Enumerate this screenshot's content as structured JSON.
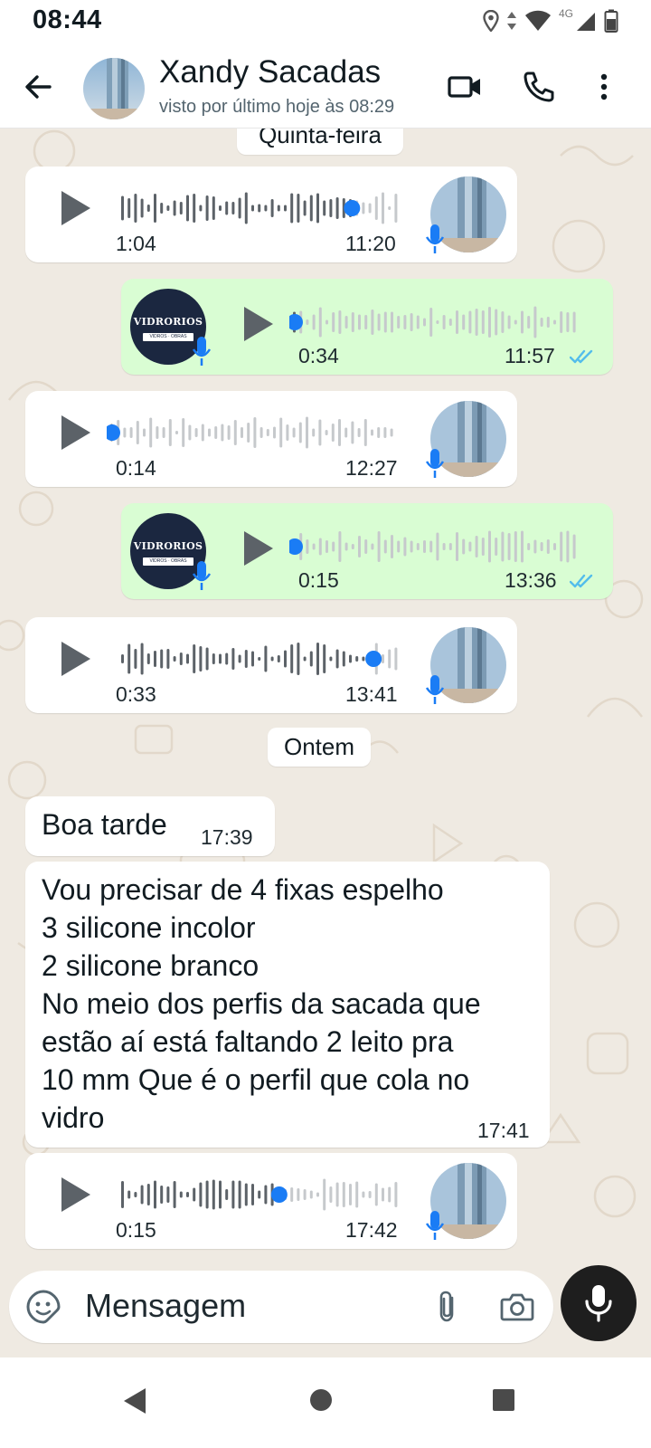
{
  "status_bar": {
    "time": "08:44",
    "network": "4G",
    "icons": [
      "location-icon",
      "data-arrows-icon",
      "wifi-icon",
      "signal-icon",
      "battery-icon"
    ]
  },
  "header": {
    "contact_name": "Xandy Sacadas",
    "contact_status": "visto por último hoje às 08:29",
    "icons": [
      "back-arrow-icon",
      "video-call-icon",
      "phone-icon",
      "more-options-icon"
    ]
  },
  "chat": {
    "top_date_label": "Quinta-feira",
    "date_separator": "Ontem",
    "messages": [
      {
        "type": "audio",
        "direction": "incoming",
        "duration": "1:04",
        "time": "11:20",
        "progress": 0.85
      },
      {
        "type": "audio",
        "direction": "outgoing",
        "duration": "0:34",
        "time": "11:57",
        "status": "read",
        "progress": 0.0
      },
      {
        "type": "audio",
        "direction": "incoming",
        "duration": "0:14",
        "time": "12:27",
        "progress": 0.0
      },
      {
        "type": "audio",
        "direction": "outgoing",
        "duration": "0:15",
        "time": "13:36",
        "status": "read",
        "progress": 0.0
      },
      {
        "type": "audio",
        "direction": "incoming",
        "duration": "0:33",
        "time": "13:41",
        "progress": 0.93
      },
      {
        "type": "text",
        "direction": "incoming",
        "text": "Boa tarde",
        "time": "17:39"
      },
      {
        "type": "text",
        "direction": "incoming",
        "text": "Vou precisar de 4 fixas espelho\n3 silicone incolor\n2 silicone branco\nNo meio dos perfis da sacada que\nestão aí está faltando 2 leito pra\n10 mm Que é o perfil que cola no\nvidro",
        "time": "17:41"
      },
      {
        "type": "audio",
        "direction": "incoming",
        "duration": "0:15",
        "time": "17:42",
        "progress": 0.58
      }
    ],
    "logo_text": "VIDRORIOS",
    "logo_subtext": "VIDROS · OBRAS"
  },
  "input": {
    "placeholder": "Mensagem",
    "icons": [
      "sticker-icon",
      "attach-icon",
      "camera-icon",
      "mic-icon"
    ]
  },
  "navigation": {
    "icons": [
      "nav-back-icon",
      "nav-home-icon",
      "nav-recents-icon"
    ]
  },
  "colors": {
    "chat_background": "#efeae2",
    "incoming_bubble": "#ffffff",
    "outgoing_bubble": "#d9fdd3",
    "progress_dot": "#1a7cf5",
    "read_ticks": "#53bdeb",
    "waveform_played": "#5c6268",
    "waveform_unplayed": "#c6c9cc"
  }
}
